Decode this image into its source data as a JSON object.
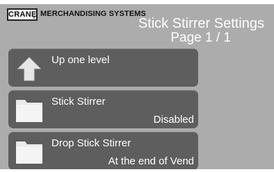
{
  "brand": {
    "logo_text": "CRANE",
    "subtitle": "MERCHANDISING SYSTEMS"
  },
  "header": {
    "title": "Stick Stirrer Settings",
    "page": "Page 1 / 1"
  },
  "menu": {
    "items": [
      {
        "label": "Up one level",
        "value": "",
        "icon": "up-arrow-icon"
      },
      {
        "label": "Stick Stirrer",
        "value": "Disabled",
        "icon": "folder-icon"
      },
      {
        "label": "Drop Stick Stirrer",
        "value": "At the end of Vend",
        "icon": "folder-icon"
      }
    ]
  },
  "colors": {
    "background": "#acacac",
    "button": "#5e5e5e",
    "text": "#ffffff"
  }
}
